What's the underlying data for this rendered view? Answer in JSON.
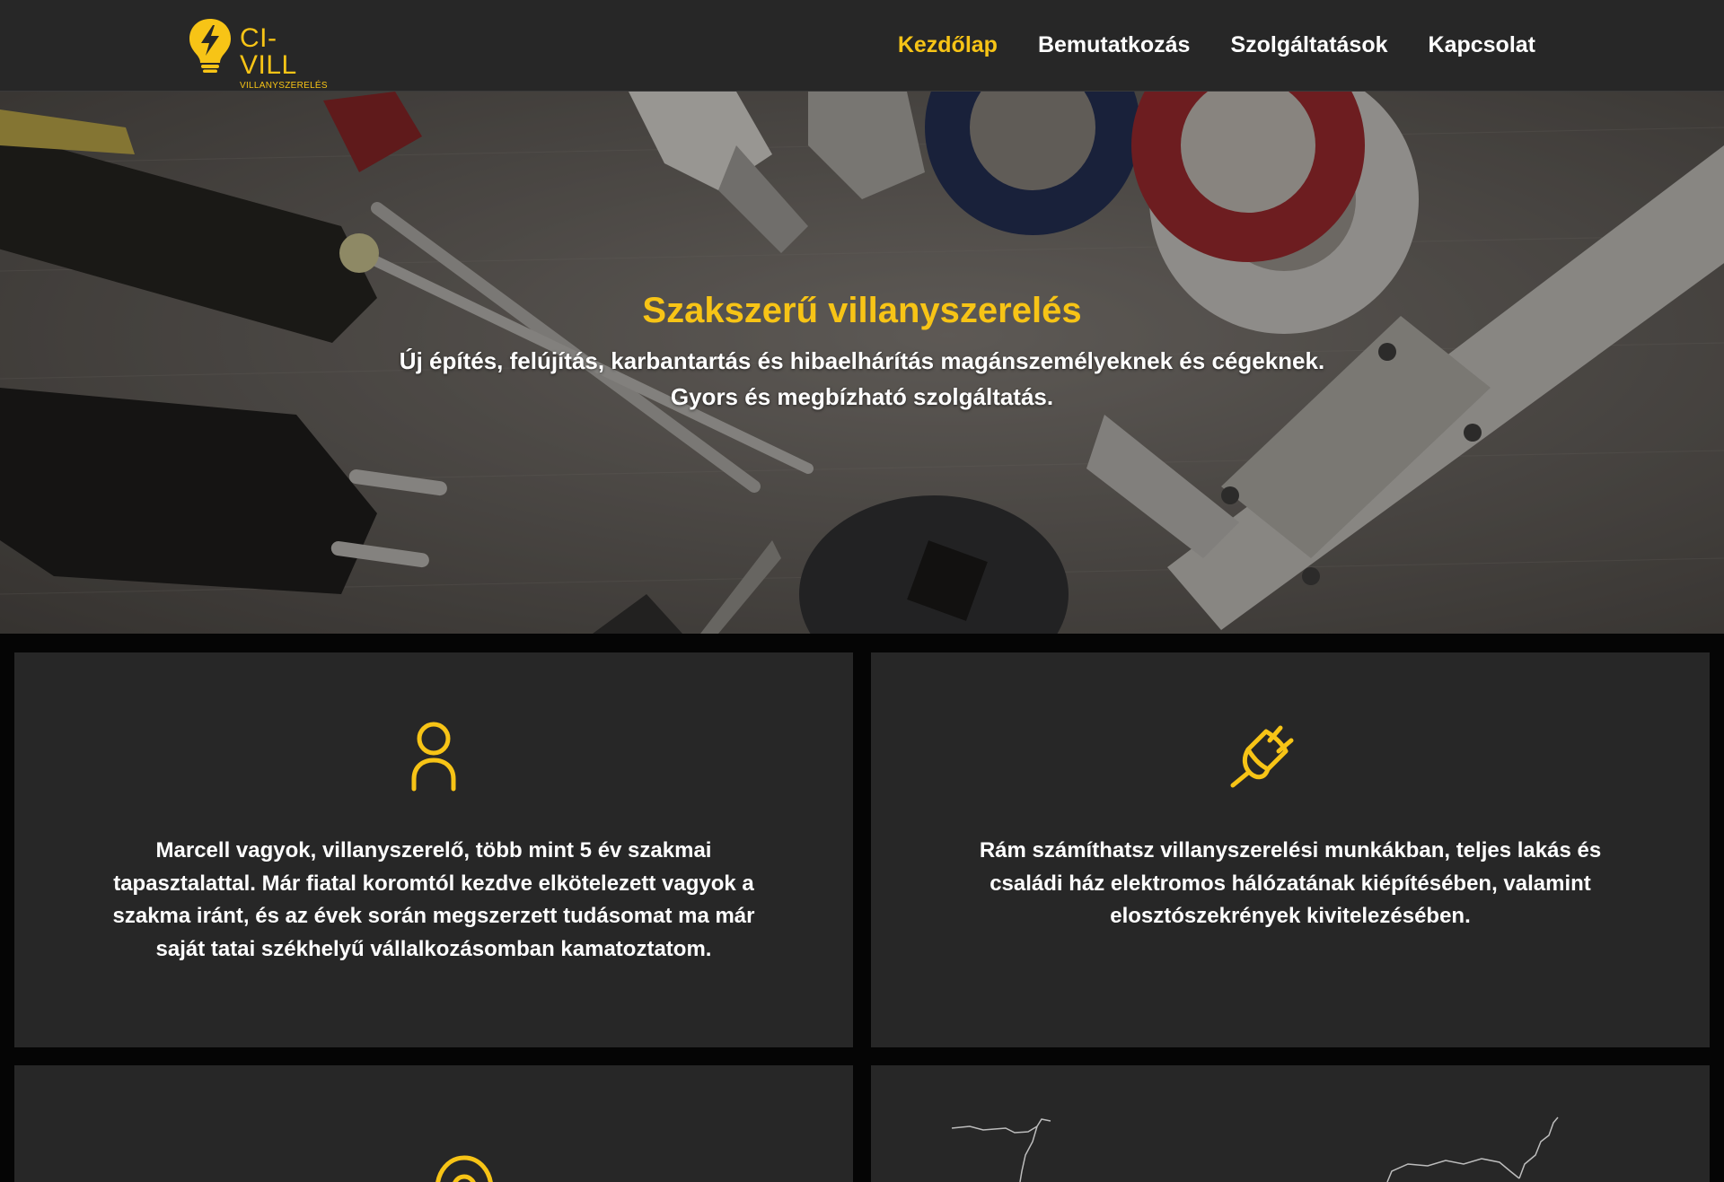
{
  "brand": {
    "name": "CI-VILL",
    "tagline": "VILLANYSZERELÉS",
    "accent_color": "#f7c416",
    "logo_icon": "lightbulb-bolt-icon"
  },
  "nav": {
    "items": [
      {
        "label": "Kezdőlap",
        "active": true
      },
      {
        "label": "Bemutatkozás",
        "active": false
      },
      {
        "label": "Szolgáltatások",
        "active": false
      },
      {
        "label": "Kapcsolat",
        "active": false
      }
    ]
  },
  "hero": {
    "title": "Szakszerű villanyszerelés",
    "line1": "Új építés, felújítás, karbantartás és hibaelhárítás magánszemélyeknek és cégeknek.",
    "line2": "Gyors és megbízható szolgáltatás."
  },
  "cards": [
    {
      "icon": "user-icon",
      "lines": [
        "Marcell vagyok, villanyszerelő, több mint 5 év szakmai",
        "tapasztalattal. Már fiatal koromtól kezdve elkötelezett vagyok a",
        "szakma iránt, és az évek során megszerzett tudásomat ma már",
        "saját tatai székhelyű vállalkozásomban kamatoztatom."
      ]
    },
    {
      "icon": "plug-icon",
      "lines": [
        "Rám számíthatsz villanyszerelési munkákban, teljes lakás és",
        "családi ház elektromos hálózatának kiépítésében, valamint",
        "elosztószekrények kivitelezésében."
      ]
    },
    {
      "icon": "location-pin-icon"
    },
    {
      "icon": "map-outline"
    }
  ]
}
